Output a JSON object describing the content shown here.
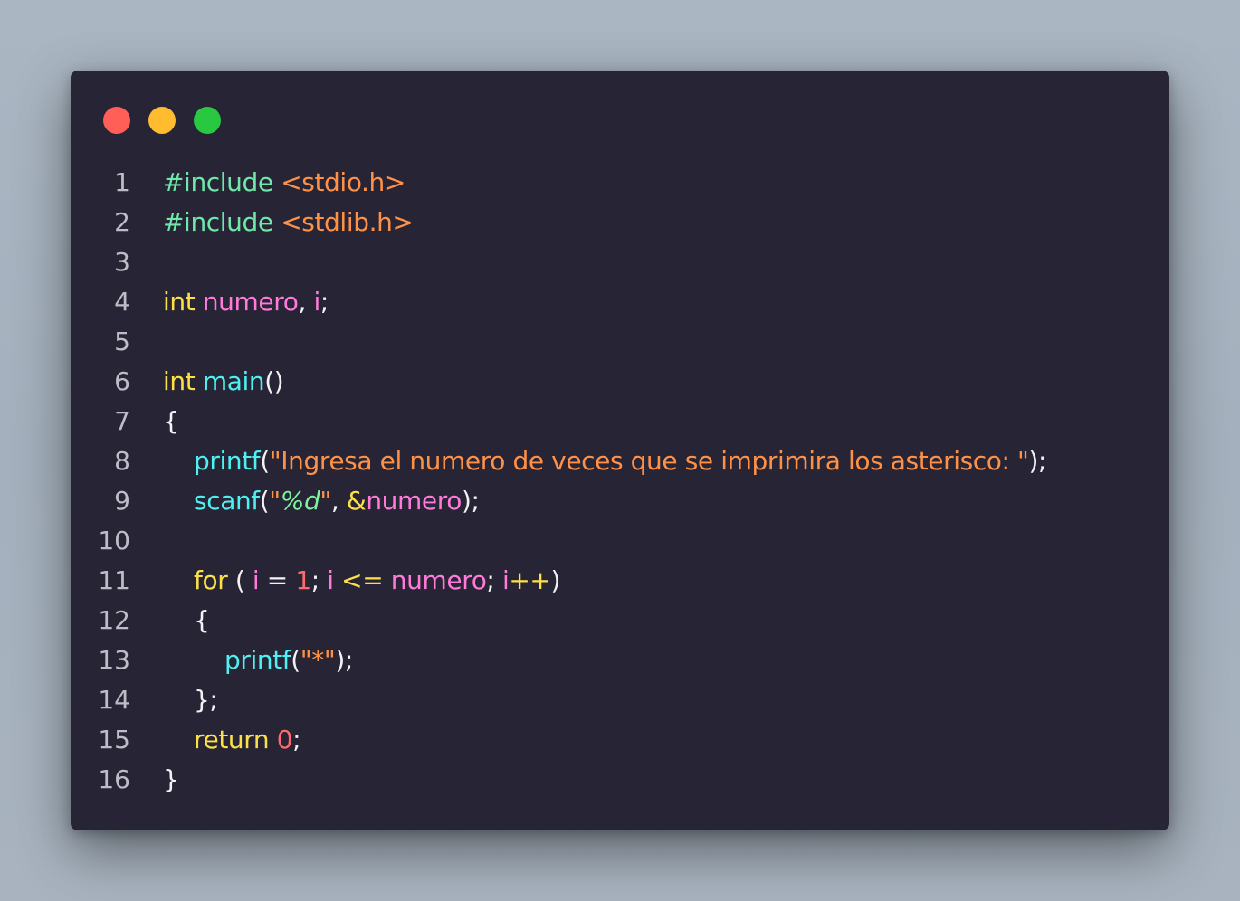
{
  "window": {
    "controls": [
      {
        "name": "close",
        "color": "#ff5f57"
      },
      {
        "name": "minimize",
        "color": "#febc2e"
      },
      {
        "name": "zoom",
        "color": "#28c840"
      }
    ],
    "background": "#262435"
  },
  "code": {
    "lines": [
      {
        "n": "1",
        "tokens": [
          {
            "t": "#include",
            "c": "pre"
          },
          {
            "t": " ",
            "c": "pun"
          },
          {
            "t": "<stdio.h>",
            "c": "hdr"
          }
        ]
      },
      {
        "n": "2",
        "tokens": [
          {
            "t": "#include",
            "c": "pre"
          },
          {
            "t": " ",
            "c": "pun"
          },
          {
            "t": "<stdlib.h>",
            "c": "hdr"
          }
        ]
      },
      {
        "n": "3",
        "tokens": []
      },
      {
        "n": "4",
        "tokens": [
          {
            "t": "int",
            "c": "kw"
          },
          {
            "t": " ",
            "c": "pun"
          },
          {
            "t": "numero",
            "c": "var"
          },
          {
            "t": ", ",
            "c": "pun"
          },
          {
            "t": "i",
            "c": "var"
          },
          {
            "t": ";",
            "c": "pun"
          }
        ]
      },
      {
        "n": "5",
        "tokens": []
      },
      {
        "n": "6",
        "tokens": [
          {
            "t": "int",
            "c": "kw"
          },
          {
            "t": " ",
            "c": "pun"
          },
          {
            "t": "main",
            "c": "fn"
          },
          {
            "t": "()",
            "c": "pun"
          }
        ]
      },
      {
        "n": "7",
        "tokens": [
          {
            "t": "{",
            "c": "pun"
          }
        ]
      },
      {
        "n": "8",
        "tokens": [
          {
            "t": "    ",
            "c": "pun"
          },
          {
            "t": "printf",
            "c": "fn"
          },
          {
            "t": "(",
            "c": "pun"
          },
          {
            "t": "\"Ingresa el numero de veces que se imprimira los asterisco: \"",
            "c": "str"
          },
          {
            "t": ");",
            "c": "pun"
          }
        ]
      },
      {
        "n": "9",
        "tokens": [
          {
            "t": "    ",
            "c": "pun"
          },
          {
            "t": "scanf",
            "c": "fn"
          },
          {
            "t": "(",
            "c": "pun"
          },
          {
            "t": "\"",
            "c": "str"
          },
          {
            "t": "%d",
            "c": "fmt"
          },
          {
            "t": "\"",
            "c": "str"
          },
          {
            "t": ", ",
            "c": "pun"
          },
          {
            "t": "&",
            "c": "amp"
          },
          {
            "t": "numero",
            "c": "var"
          },
          {
            "t": ");",
            "c": "pun"
          }
        ]
      },
      {
        "n": "10",
        "tokens": []
      },
      {
        "n": "11",
        "tokens": [
          {
            "t": "    ",
            "c": "pun"
          },
          {
            "t": "for",
            "c": "kw"
          },
          {
            "t": " ( ",
            "c": "pun"
          },
          {
            "t": "i",
            "c": "var"
          },
          {
            "t": " = ",
            "c": "pun"
          },
          {
            "t": "1",
            "c": "num"
          },
          {
            "t": "; ",
            "c": "pun"
          },
          {
            "t": "i",
            "c": "var"
          },
          {
            "t": " <= ",
            "c": "kw"
          },
          {
            "t": "numero",
            "c": "var"
          },
          {
            "t": "; ",
            "c": "pun"
          },
          {
            "t": "i",
            "c": "var"
          },
          {
            "t": "++",
            "c": "kw"
          },
          {
            "t": ")",
            "c": "pun"
          }
        ]
      },
      {
        "n": "12",
        "tokens": [
          {
            "t": "    ",
            "c": "pun"
          },
          {
            "t": "{",
            "c": "pun"
          }
        ]
      },
      {
        "n": "13",
        "tokens": [
          {
            "t": "        ",
            "c": "pun"
          },
          {
            "t": "printf",
            "c": "fn"
          },
          {
            "t": "(",
            "c": "pun"
          },
          {
            "t": "\"*\"",
            "c": "str"
          },
          {
            "t": ");",
            "c": "pun"
          }
        ]
      },
      {
        "n": "14",
        "tokens": [
          {
            "t": "    ",
            "c": "pun"
          },
          {
            "t": "};",
            "c": "pun"
          }
        ]
      },
      {
        "n": "15",
        "tokens": [
          {
            "t": "    ",
            "c": "pun"
          },
          {
            "t": "return",
            "c": "kw"
          },
          {
            "t": " ",
            "c": "pun"
          },
          {
            "t": "0",
            "c": "num"
          },
          {
            "t": ";",
            "c": "pun"
          }
        ]
      },
      {
        "n": "16",
        "tokens": [
          {
            "t": "}",
            "c": "pun"
          }
        ]
      }
    ]
  }
}
